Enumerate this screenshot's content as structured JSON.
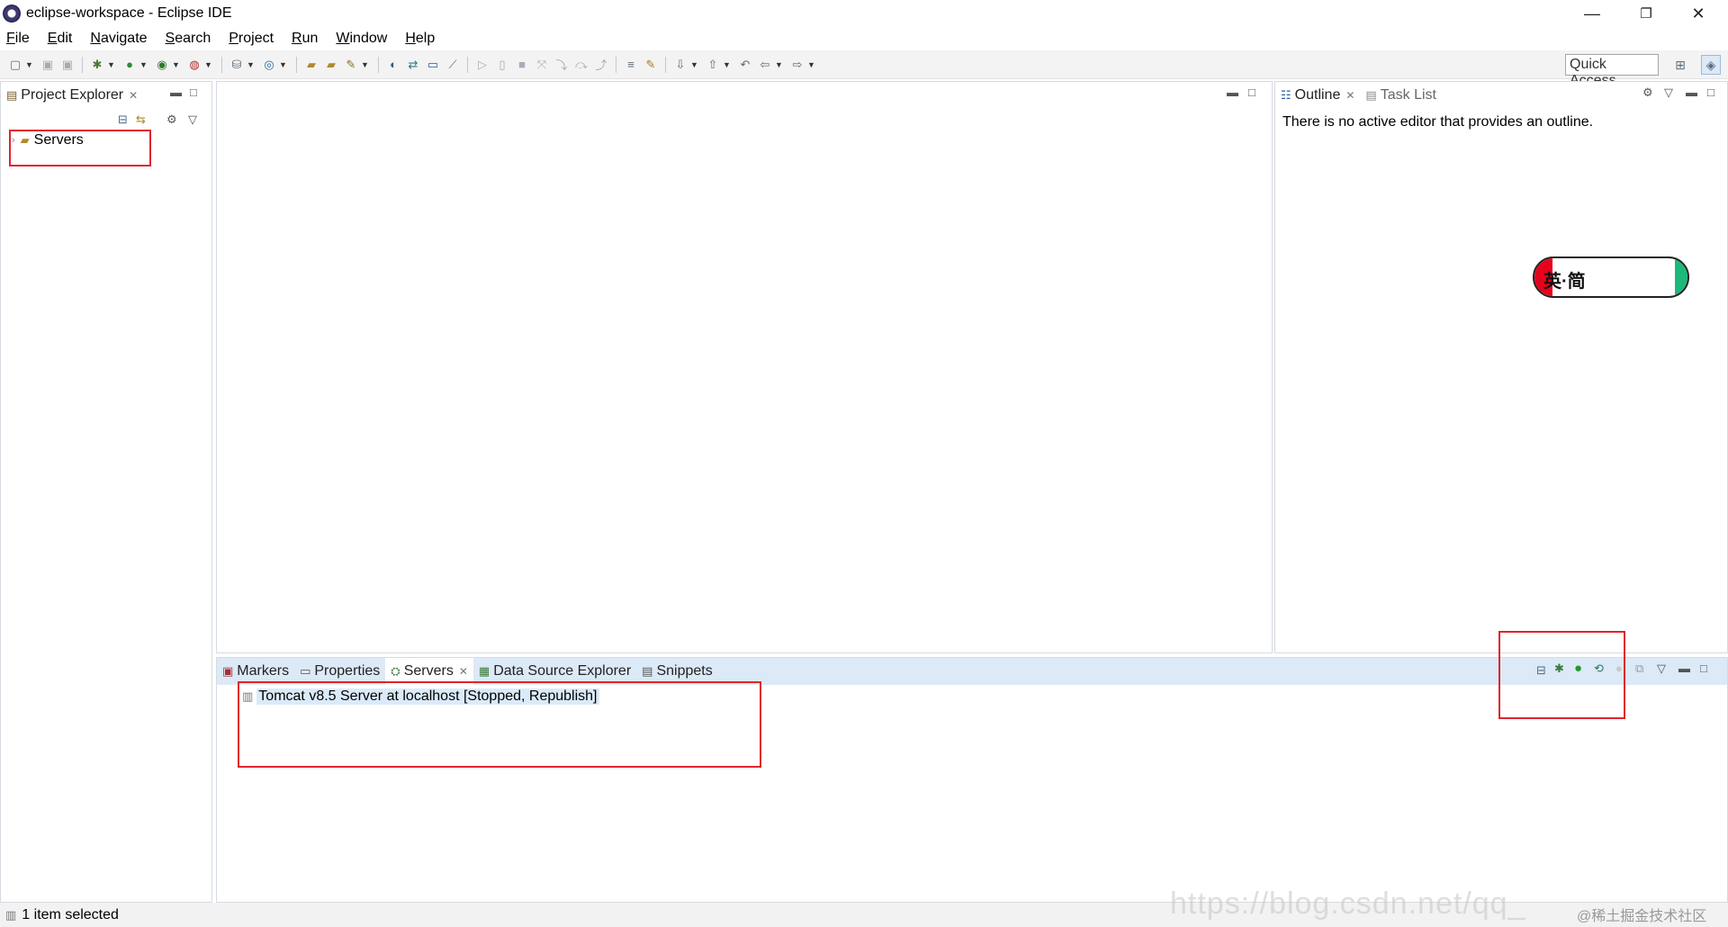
{
  "window": {
    "title": "eclipse-workspace - Eclipse IDE",
    "minimize_glyph": "—",
    "restore_glyph": "❐",
    "close_glyph": "✕"
  },
  "menubar": {
    "items": [
      "File",
      "Edit",
      "Navigate",
      "Search",
      "Project",
      "Run",
      "Window",
      "Help"
    ]
  },
  "toolbar": {
    "quick_access_placeholder": "Quick Access"
  },
  "project_explorer": {
    "tab_label": "Project Explorer",
    "tree_items": [
      {
        "label": "Servers",
        "expand_glyph": "›"
      }
    ]
  },
  "outline": {
    "tab_label": "Outline",
    "inactive_tab_label": "Task List",
    "message": "There is no active editor that provides an outline."
  },
  "logo": {
    "text": "英·简"
  },
  "bottom_panel": {
    "tabs": [
      {
        "label": "Markers",
        "icon": "markers-icon"
      },
      {
        "label": "Properties",
        "icon": "properties-icon"
      },
      {
        "label": "Servers",
        "icon": "servers-icon",
        "active": true
      },
      {
        "label": "Data Source Explorer",
        "icon": "data-source-icon"
      },
      {
        "label": "Snippets",
        "icon": "snippets-icon"
      }
    ],
    "server_entry": "Tomcat v8.5 Server at localhost  [Stopped, Republish]"
  },
  "statusbar": {
    "text": "1 item selected"
  },
  "watermark": {
    "url_text": "https://blog.csdn.net/qq_",
    "site_text": "@稀土掘金技术社区"
  },
  "colors": {
    "highlight_box": "#e0242b",
    "panel_header_blue": "#dce9f7",
    "selection": "#dbeaf8"
  }
}
